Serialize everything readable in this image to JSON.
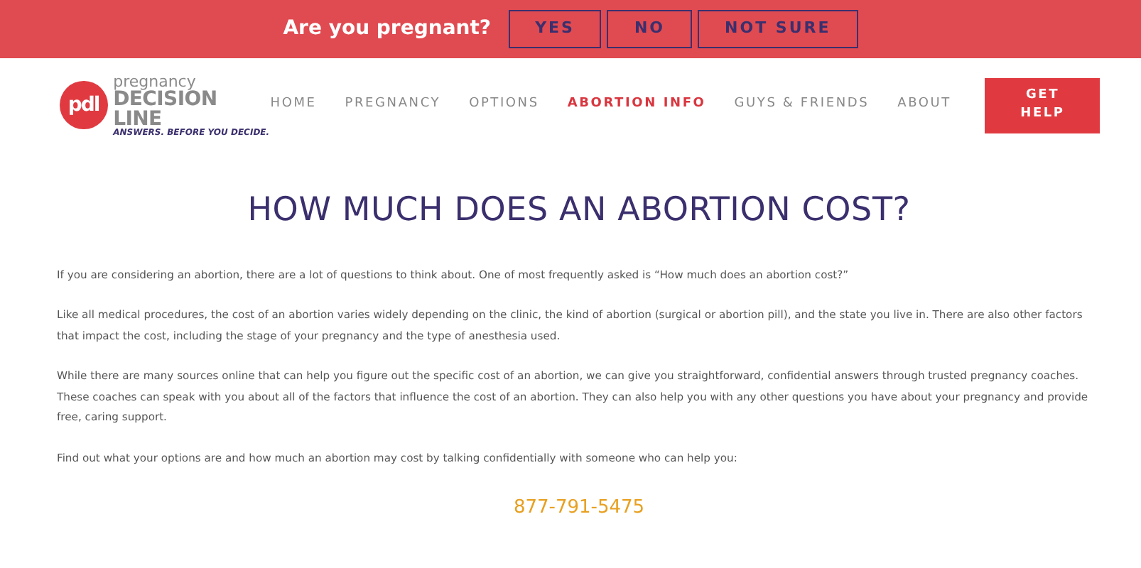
{
  "top_bar": {
    "question": "Are you pregnant?",
    "buttons": [
      "YES",
      "NO",
      "NOT SURE"
    ]
  },
  "logo": {
    "mark": "pdl",
    "line_1": "pregnancy",
    "line_2": "DECISION LINE",
    "tagline": "ANSWERS. BEFORE YOU DECIDE."
  },
  "nav": {
    "items": [
      {
        "label": "HOME",
        "selected": false
      },
      {
        "label": "PREGNANCY",
        "selected": false
      },
      {
        "label": "OPTIONS",
        "selected": false
      },
      {
        "label": "ABORTION INFO",
        "selected": true
      },
      {
        "label": "GUYS & FRIENDS",
        "selected": false
      },
      {
        "label": "ABOUT",
        "selected": false
      }
    ],
    "cta": "GET HELP"
  },
  "article": {
    "title": "HOW MUCH DOES AN ABORTION COST?",
    "paragraphs": [
      "If you are considering an abortion, there are a lot of questions to think about. One of most frequently asked is “How much does an abortion cost?”",
      "Like all medical procedures, the cost of an abortion varies widely depending on the clinic, the kind of abortion (surgical or abortion pill), and the state you live in. There are also other factors that impact the cost, including the stage of your pregnancy and the type of anesthesia used.",
      "While there are many sources online that can help you figure out the specific cost of an abortion, we can give you straightforward, confidential answers through trusted pregnancy coaches. These coaches can speak with you about all of the factors that influence the cost of an abortion. They can also help you with any other questions you have about your pregnancy and provide free, caring support.",
      "Find out what your options are and how much an abortion may cost by talking confidentially with someone who can help you:"
    ],
    "phone": "877-791-5475"
  }
}
